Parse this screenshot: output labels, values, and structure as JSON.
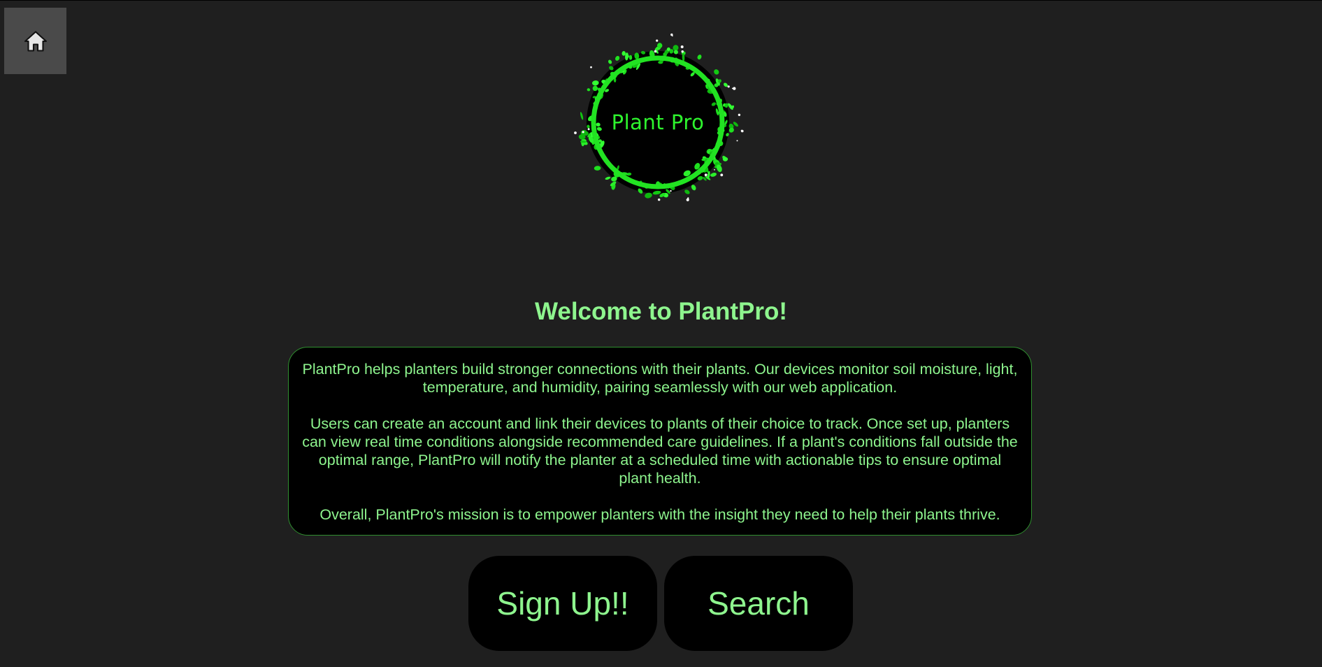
{
  "nav": {
    "home_icon": "home-icon"
  },
  "logo": {
    "text": "Plant Pro"
  },
  "welcome": {
    "title": "Welcome to PlantPro!"
  },
  "about": {
    "paragraphs": [
      "PlantPro helps planters build stronger connections with their plants. Our devices monitor soil moisture, light, temperature, and humidity, pairing seamlessly with our web application.",
      "Users can create an account and link their devices to plants of their choice to track. Once set up, planters can view real time conditions alongside recommended care guidelines. If a plant's conditions fall outside the optimal range, PlantPro will notify the planter at a scheduled time with actionable tips to ensure optimal plant health.",
      "Overall, PlantPro's mission is to empower planters with the insight they need to help their plants thrive."
    ]
  },
  "actions": {
    "signup_label": "Sign Up!!",
    "search_label": "Search"
  },
  "colors": {
    "background": "#1f1f1f",
    "accent_text": "#8ef58e",
    "logo_green": "#2ef52e",
    "box_background": "#000000",
    "home_button": "#4a4a4a"
  }
}
